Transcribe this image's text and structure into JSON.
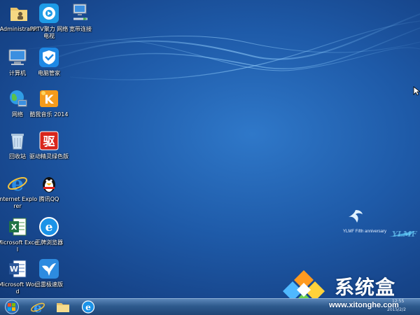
{
  "desktop_icons": [
    {
      "label": "Administrator",
      "icon": "user-folder-icon"
    },
    {
      "label": "PPTV聚力 网络电视",
      "icon": "pptv-icon"
    },
    {
      "label": "宽带连接",
      "icon": "network-connection-icon"
    },
    {
      "label": "计算机",
      "icon": "computer-icon"
    },
    {
      "label": "电脑管家",
      "icon": "shield-icon"
    },
    {
      "label": "网络",
      "icon": "network-globe-icon"
    },
    {
      "label": "酷我音乐 2014",
      "icon": "kuwo-music-icon"
    },
    {
      "label": "回收站",
      "icon": "recycle-bin-icon"
    },
    {
      "label": "驱动精灵绿色版",
      "icon": "driver-genius-icon"
    },
    {
      "label": "Internet Explorer",
      "icon": "ie-icon"
    },
    {
      "label": "腾讯QQ",
      "icon": "qq-penguin-icon"
    },
    {
      "label": "Microsoft Excel",
      "icon": "excel-icon"
    },
    {
      "label": "王牌浏览器",
      "icon": "browser-icon"
    },
    {
      "label": "Microsoft Word",
      "icon": "word-icon"
    },
    {
      "label": "迅雷极速版",
      "icon": "thunder-bird-icon"
    }
  ],
  "wallpaper": {
    "caption": "YLMF Fifth anniversary"
  },
  "watermark": {
    "title": "系统盒",
    "url": "www.xitonghe.com"
  },
  "taskbar": {
    "clock_time": "12:55",
    "clock_date": "2015/2/2",
    "items": [
      "start-orb",
      "ie-icon",
      "explorer-folder-icon",
      "ie-icon"
    ]
  },
  "colors": {
    "desktop": "#1e5aa8",
    "taskbar": "#2e5a8d",
    "accent": "#3aa0ff"
  }
}
